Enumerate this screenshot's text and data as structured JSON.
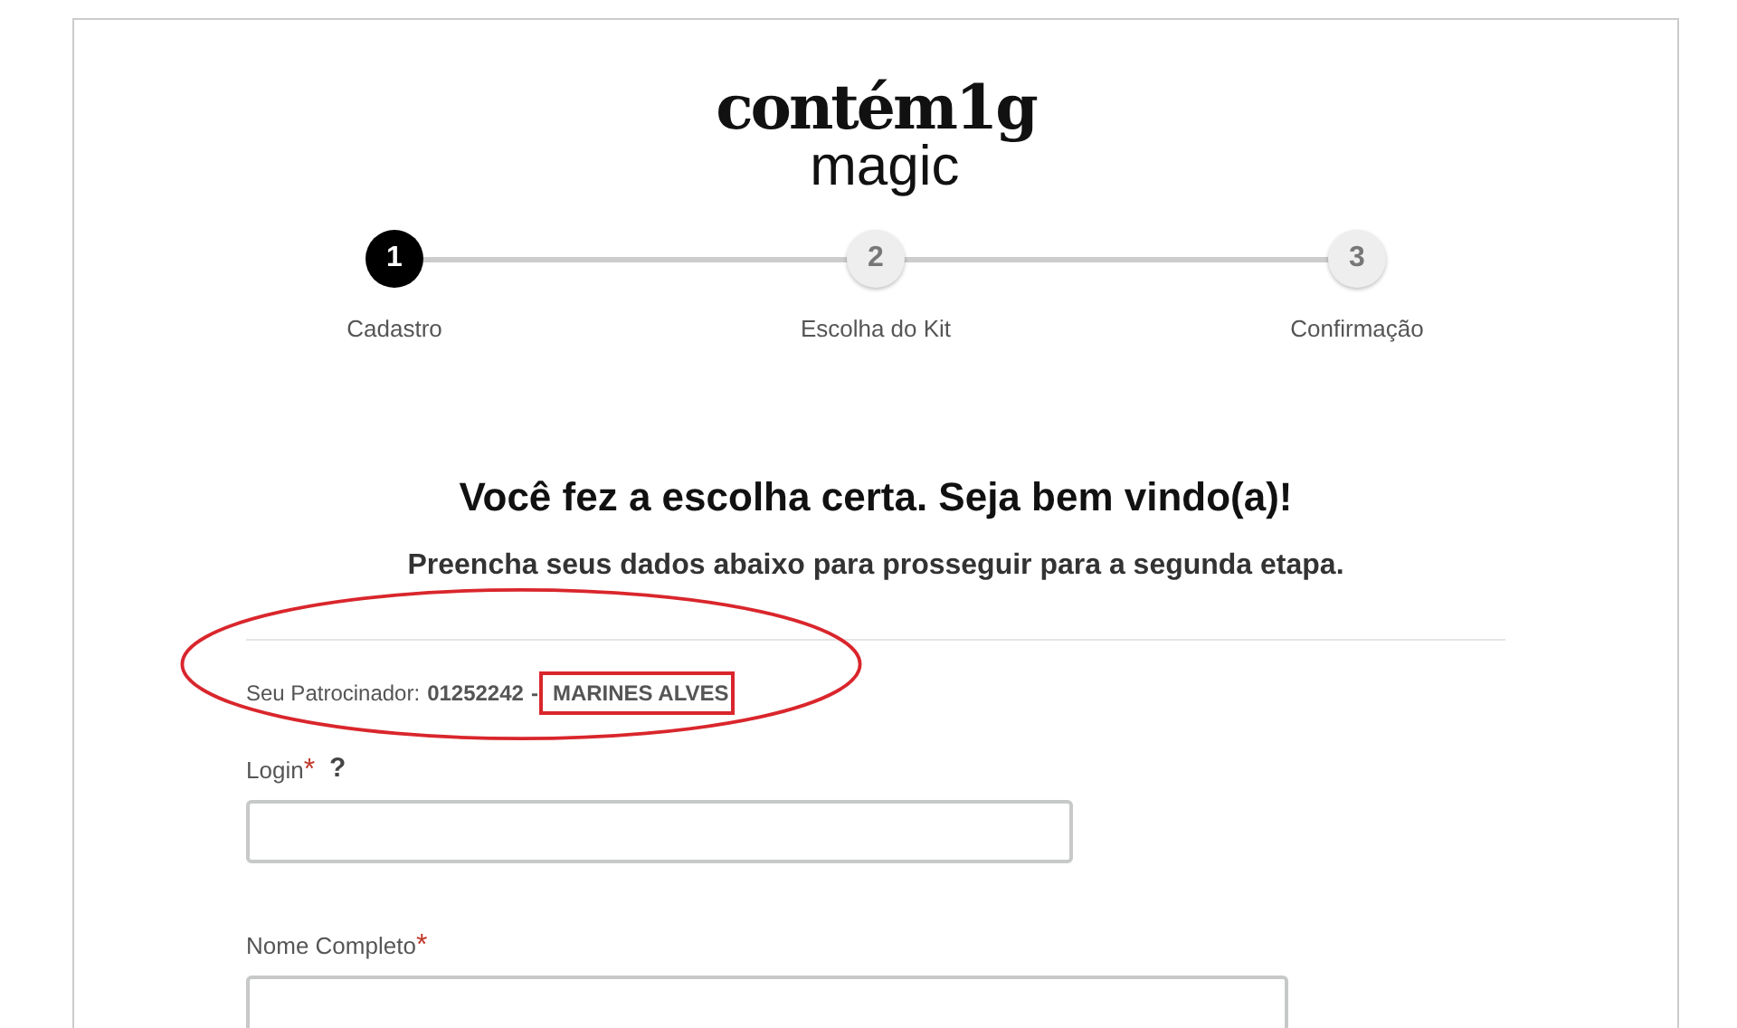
{
  "logo": {
    "line_1": "contém1g",
    "line_2": "magic"
  },
  "steps": [
    {
      "number": "1",
      "label": "Cadastro",
      "selected": true
    },
    {
      "number": "2",
      "label": "Escolha do Kit",
      "selected": false
    },
    {
      "number": "3",
      "label": "Confirmação",
      "selected": false
    }
  ],
  "heading": "Você fez a escolha certa. Seja bem vindo(a)!",
  "subheading": "Preencha seus dados abaixo para prosseguir para a segunda etapa.",
  "sponsor": {
    "label": "Seu Patrocinador:",
    "code": "01252242",
    "separator": "-",
    "name": "MARINES ALVES",
    "circled": true,
    "boxed": true
  },
  "fields": [
    {
      "label": "Login",
      "required_mark": "*",
      "help": "?"
    },
    {
      "label": "Nome Completo",
      "required_mark": "*"
    }
  ]
}
